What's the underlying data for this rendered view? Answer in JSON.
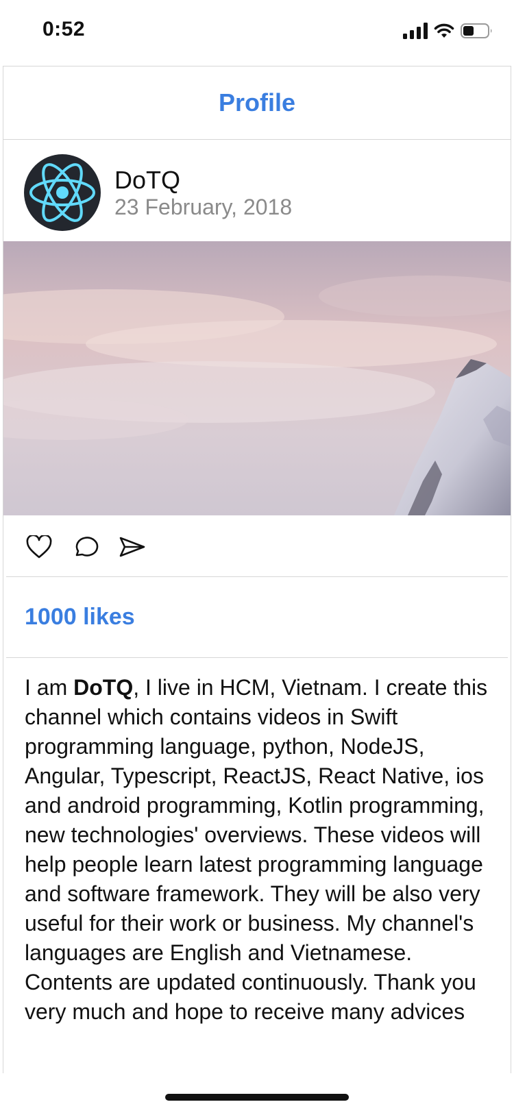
{
  "status_bar": {
    "time": "0:52",
    "icons": [
      "cellular-signal-icon",
      "wifi-icon",
      "battery-icon"
    ],
    "battery_level": 0.45
  },
  "header": {
    "title": "Profile"
  },
  "post": {
    "author": "DoTQ",
    "date": "23 February, 2018",
    "avatar_icon": "react-logo-icon",
    "image": "snowy-mountain-peak-at-sunrise",
    "actions": [
      "heart-icon",
      "comment-icon",
      "send-icon"
    ],
    "likes": "1000 likes",
    "caption_prefix": "I am ",
    "caption_bold": "DoTQ",
    "caption_rest": ", I live in HCM, Vietnam. I create this channel which contains videos in Swift programming language, python, NodeJS, Angular, Typescript,  ReactJS, React Native, ios and android programming, Kotlin programming, new technologies' overviews. These videos will help people learn latest programming language and software framework. They will be also very useful for their work or business. My channel's languages are English and Vietnamese. Contents are updated continuously. Thank you very much and hope to receive many advices"
  },
  "colors": {
    "accent": "#3a7ee0",
    "avatar_bg": "#23272e",
    "react_blue": "#61dafb",
    "divider": "#d6d6d6",
    "date_gray": "#8a8a8a"
  }
}
